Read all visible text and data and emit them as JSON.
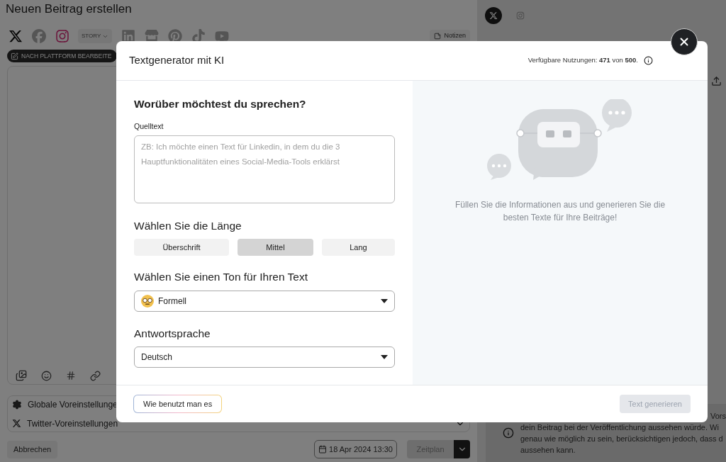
{
  "editor": {
    "title": "Neuen Beitrag erstellen",
    "platforms": [
      {
        "selected": true
      },
      {
        "selected": false
      },
      {
        "selected": true
      },
      {
        "selected": false
      },
      {
        "selected": false
      },
      {
        "selected": false
      },
      {
        "selected": false
      },
      {
        "selected": false
      }
    ],
    "story_menu": "STORY",
    "notes_button": "Notizen",
    "edit_by_platform": "NACH PLATTFORM BEARBEITE",
    "presets": [
      "Globale Voreinstellunge",
      "Twitter-Voreinstellungen"
    ],
    "cancel_button": "Abbrechen",
    "date": "18 Apr 2024 13:30",
    "schedule_button": "Zeitplan"
  },
  "preview": {
    "tabs": [
      {
        "selected": true
      },
      {
        "selected": false
      }
    ],
    "info_lines": [
      "Vors",
      "dein Beitrag bei der Veröffentlichung aussehen würde. Wi",
      "genau wie möglich zu sein, berücksichtigen jedoch, dass d",
      "aussehen kann."
    ]
  },
  "dialog": {
    "title": "Textgenerator mit KI",
    "usage": "Verfügbare Nutzungen: **471** von **500**.",
    "topic_heading": "Worüber möchtest du sprechen?",
    "source_label": "Quelltext",
    "source_placeholder": "ZB: Ich möchte einen Text für Linkedin, in dem du die 3 Hauptfunktionalitäten eines Social-Media-Tools erklärst",
    "length_heading": "Wählen Sie die Länge",
    "lengths": [
      {
        "label": "Überschrift",
        "selected": false
      },
      {
        "label": "Mittel",
        "selected": true
      },
      {
        "label": "Lang",
        "selected": false
      }
    ],
    "tone_heading": "Wählen Sie einen Ton für Ihren Text",
    "tone": "Formell",
    "language_heading": "Antwortsprache",
    "language": "Deutsch",
    "empty_message": "Füllen Sie die Informationen aus und generieren Sie die besten Texte für Ihre Beiträge!",
    "help_button": "Wie benutzt man es",
    "generate_button": {
      "label": "Text generieren",
      "disabled": true
    }
  }
}
